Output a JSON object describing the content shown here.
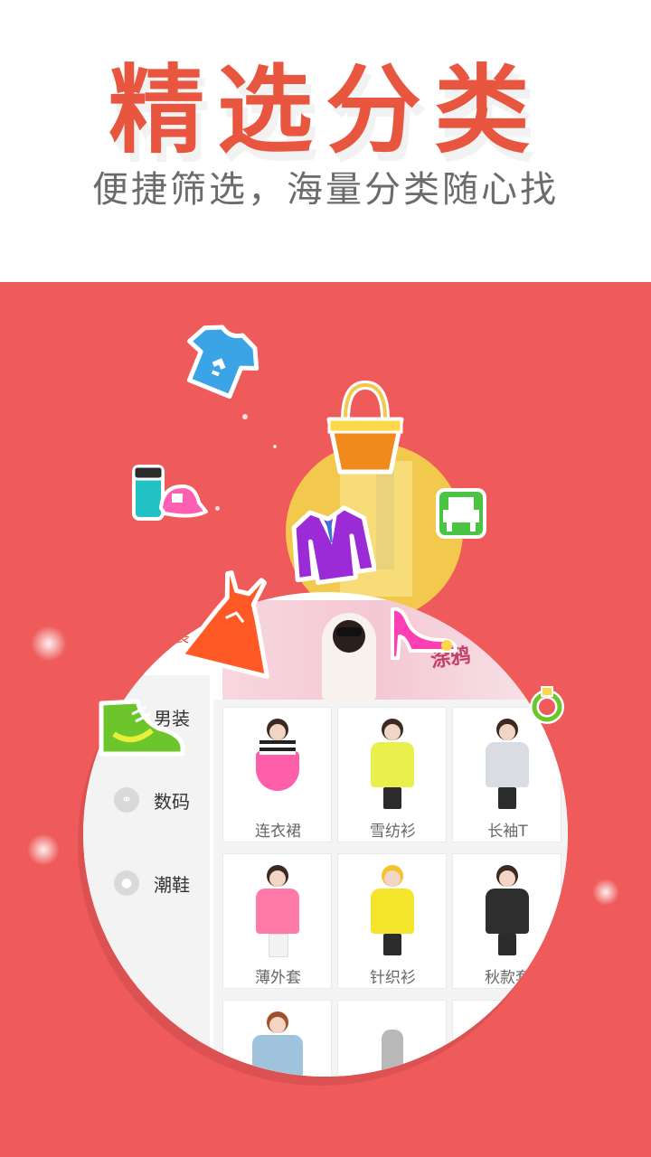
{
  "header": {
    "title": "精选分类",
    "subtitle": "便捷筛选，海量分类随心找"
  },
  "colors": {
    "accent": "#e8563f",
    "stage_bg": "#ef5a5a"
  },
  "sidebar": {
    "items": [
      {
        "label": "女装",
        "icon": "dress-icon",
        "active": true
      },
      {
        "label": "男装",
        "icon": "shirt-icon",
        "active": false
      },
      {
        "label": "数码",
        "icon": "headphones-icon",
        "active": false
      },
      {
        "label": "潮鞋",
        "icon": "shoe-icon",
        "active": false
      }
    ]
  },
  "banner": {
    "promo_text": "涂鸦"
  },
  "grid": {
    "items": [
      {
        "label": "连衣裙",
        "color": "#ff5fa8"
      },
      {
        "label": "雪纺衫",
        "color": "#e9ef4d"
      },
      {
        "label": "长袖T",
        "color": "#d9dde3"
      },
      {
        "label": "薄外套",
        "color": "#ff7aa6"
      },
      {
        "label": "针织衫",
        "color": "#f4e52a"
      },
      {
        "label": "秋款套",
        "color": "#2e2e2e"
      },
      {
        "label": "",
        "color": "#9fc3dc"
      },
      {
        "label": "",
        "color": "#b9b9b9"
      },
      {
        "label": "",
        "color": "#ffffff"
      }
    ]
  },
  "floating_icons": [
    "tshirt-icon",
    "handbag-icon",
    "thermos-icon",
    "cap-icon",
    "armchair-icon",
    "jacket-icon",
    "dress-icon",
    "high-heel-icon",
    "sneaker-icon",
    "ring-icon"
  ]
}
